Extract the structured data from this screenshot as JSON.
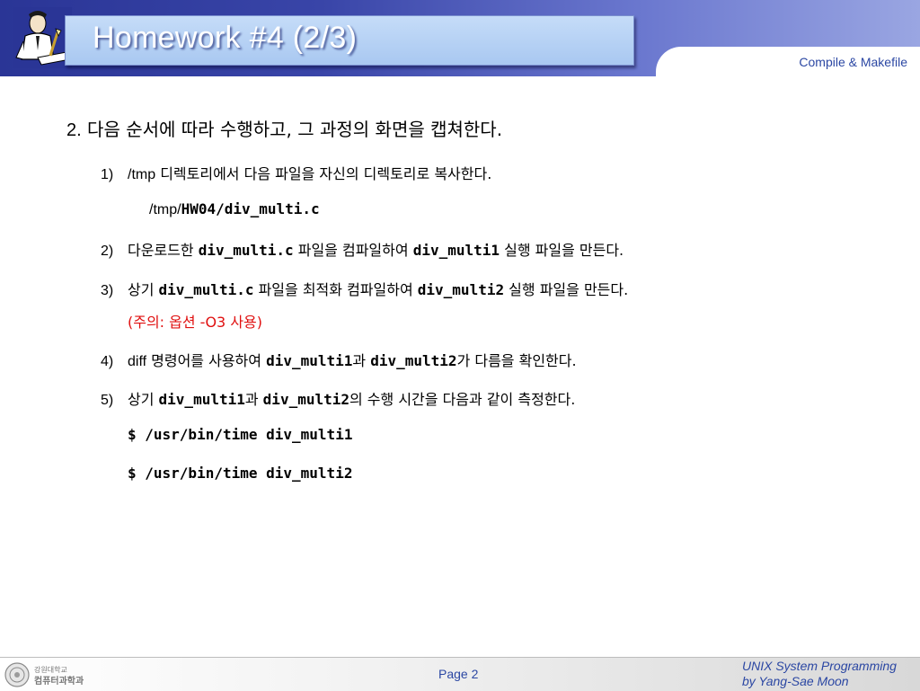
{
  "header": {
    "title": "Homework #4 (2/3)",
    "subtitle": "Compile & Makefile"
  },
  "body": {
    "item2": {
      "num": "2.",
      "text": "다음 순서에 따라 수행하고, 그 과정의 화면을 캡쳐한다."
    },
    "steps": {
      "s1": {
        "num": "1)",
        "a": "/tmp",
        "b": " 디렉토리에서 다음 파일을 자신의 디렉토리로 복사한다."
      },
      "s1_path": {
        "a": "/tmp/",
        "b": "HW04/div_multi.c"
      },
      "s2": {
        "num": "2)",
        "a": "다운로드한 ",
        "b": "div_multi.c",
        "c": " 파일을 컴파일하여 ",
        "d": "div_multi1",
        "e": " 실행 파일을 만든다."
      },
      "s3": {
        "num": "3)",
        "a": "상기 ",
        "b": "div_multi.c",
        "c": " 파일을 최적화 컴파일하여 ",
        "d": "div_multi2",
        "e": " 실행 파일을 만든다."
      },
      "s3_note": "(주의: 옵션 -O3 사용)",
      "s4": {
        "num": "4)",
        "a": "diff",
        "b": " 명령어를 사용하여 ",
        "c": "div_multi1",
        "d": "과 ",
        "e": "div_multi2",
        "f": "가 다름을 확인한다."
      },
      "s5": {
        "num": "5)",
        "a": "상기 ",
        "b": "div_multi1",
        "c": "과 ",
        "d": "div_multi2",
        "e": "의 수행 시간을 다음과 같이 측정한다."
      },
      "cmd1": "$ /usr/bin/time div_multi1",
      "cmd2": "$ /usr/bin/time div_multi2"
    }
  },
  "footer": {
    "logo_text_1": "강원대학교",
    "logo_text_2": "컴퓨터과학과",
    "page": "Page 2",
    "course_1": "UNIX System Programming",
    "course_2": "by Yang-Sae Moon"
  },
  "colors": {
    "header_blue": "#2a3596",
    "title_box": "#b4d0f5",
    "accent_text": "#2b47a3",
    "note_red": "#e01010"
  },
  "icons": {
    "header_logo": "writer-at-desk-icon",
    "footer_logo": "university-seal-icon"
  }
}
